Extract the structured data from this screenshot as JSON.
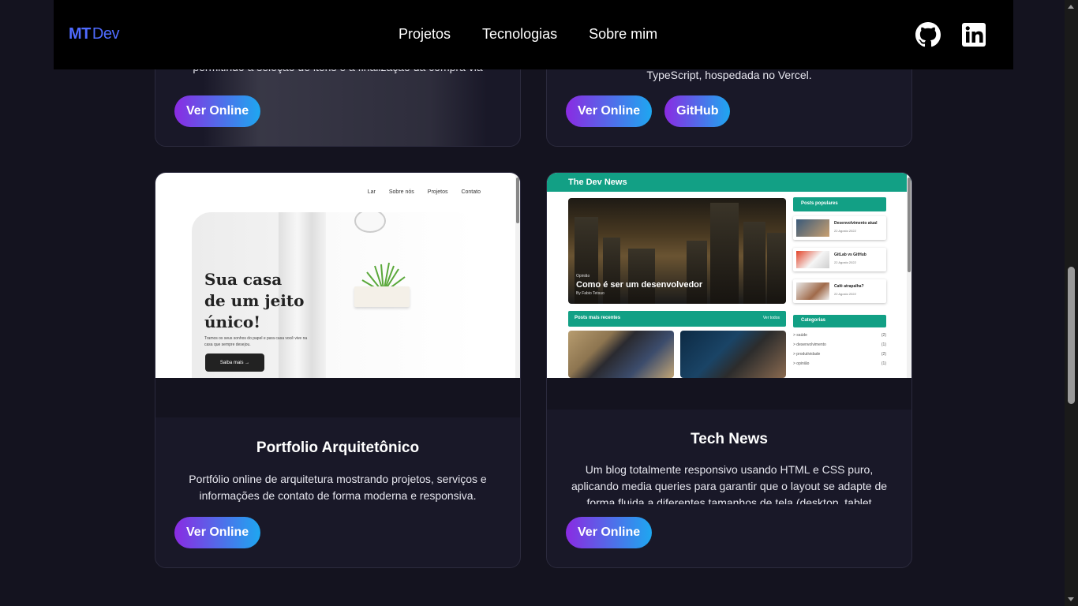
{
  "header": {
    "logo_mt": "MT",
    "logo_dev": "Dev",
    "nav": [
      "Projetos",
      "Tecnologias",
      "Sobre mim"
    ],
    "social": [
      "github-icon",
      "linkedin-icon"
    ]
  },
  "cards": {
    "top_left": {
      "desc": "permitindo a seleção de itens e a finalização da compra via",
      "buttons": [
        "Ver Online"
      ]
    },
    "top_right": {
      "desc": "TypeScript, hospedada no Vercel.",
      "buttons": [
        "Ver Online",
        "GitHub"
      ]
    },
    "bottom_left": {
      "title": "Portfolio Arquitetônico",
      "desc": "Portfólio online de arquitetura mostrando projetos, serviços e informações de contato de forma moderna e responsiva.",
      "buttons": [
        "Ver Online"
      ],
      "preview": {
        "nav": [
          "Lar",
          "Sobre nós",
          "Projetos",
          "Contato"
        ],
        "hero_title": "Sua casa de um jeito único!",
        "hero_sub": "Tramos os seus sonhos do papel e para casa você vive na casa que sempre desejou.",
        "hero_button": "Saiba mais →"
      }
    },
    "bottom_right": {
      "title": "Tech News",
      "desc": "Um blog totalmente responsivo usando HTML e CSS puro, aplicando media queries para garantir que o layout se adapte de forma fluida a diferentes tamanhos de tela (desktop, tablet",
      "buttons": [
        "Ver Online"
      ],
      "preview": {
        "brand": "The Dev News",
        "main_kicker": "Opinião",
        "main_title": "Como é ser um desenvolvedor",
        "main_author": "By Fabio Tetsuo",
        "popular_label": "Posts populares",
        "popular": [
          {
            "title": "Desenvolvimento atual",
            "date": "22 Agosto 2022"
          },
          {
            "title": "GitLab vs GitHub",
            "date": "22 Agosto 2022"
          },
          {
            "title": "Café atrapalha?",
            "date": "22 Agosto 2022"
          }
        ],
        "recent_label": "Posts mais recentes",
        "recent_more": "Ver todos",
        "categories_label": "Categorias",
        "categories": [
          {
            "name": "> saúde",
            "count": "(2)"
          },
          {
            "name": "> desenvolvimento",
            "count": "(1)"
          },
          {
            "name": "> produtividade",
            "count": "(2)"
          },
          {
            "name": "> opinião",
            "count": "(1)"
          }
        ]
      }
    }
  },
  "colors": {
    "background": "#14131f",
    "card": "#191828",
    "accent_start": "#8a2be2",
    "accent_end": "#1ea7f0",
    "logo": "#4f6bff",
    "news_green": "#12a085"
  }
}
